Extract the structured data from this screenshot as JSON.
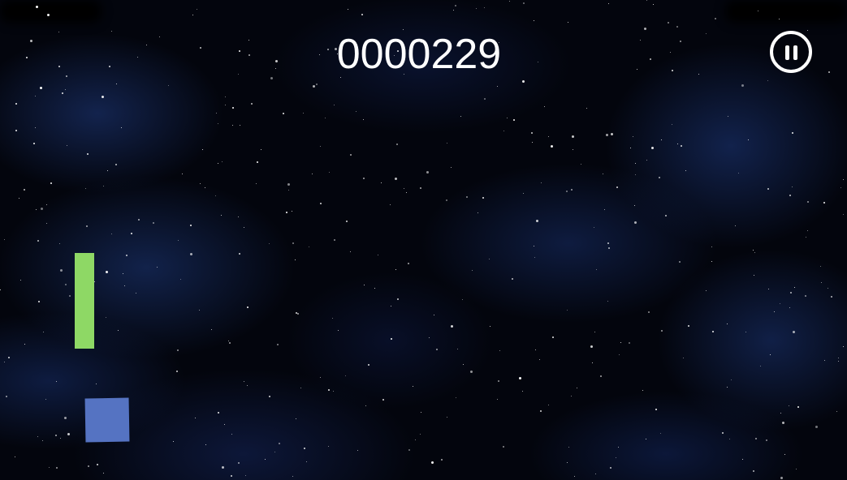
{
  "hud": {
    "score": "0000229",
    "pause_icon": "pause-icon"
  },
  "colors": {
    "background": "#03050d",
    "nebula": "#1e3a7d",
    "paddle": "#8ed865",
    "player_block": "#5573c2",
    "hud_text": "#ffffff"
  }
}
